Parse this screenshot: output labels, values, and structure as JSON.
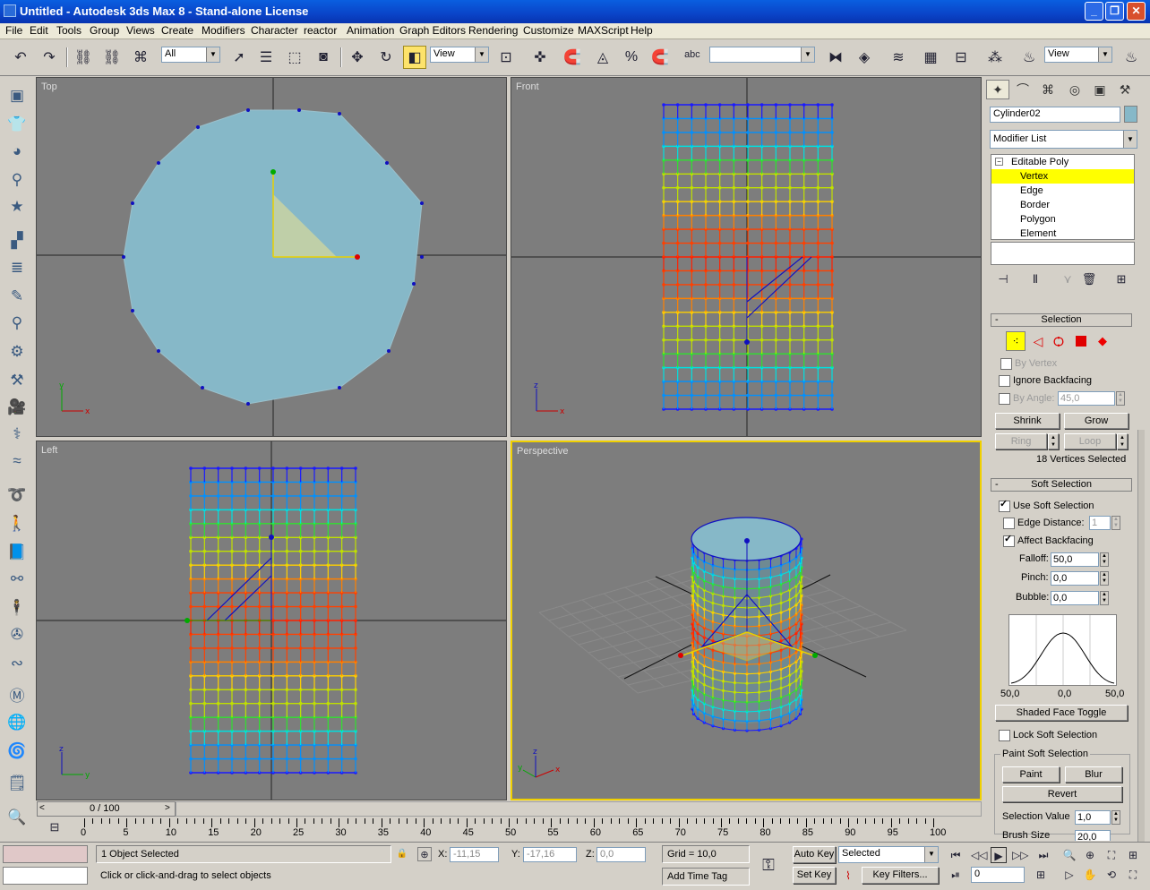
{
  "window": {
    "title": "Untitled   - Autodesk 3ds Max 8   - Stand-alone License"
  },
  "menu": [
    "File",
    "Edit",
    "Tools",
    "Group",
    "Views",
    "Create",
    "Modifiers",
    "Character",
    "reactor",
    "Animation",
    "Graph Editors",
    "Rendering",
    "Customize",
    "MAXScript",
    "Help"
  ],
  "toolbar": {
    "selection_filter": "All",
    "ref_coord": "View",
    "named_sel": "",
    "render_view": "View",
    "snap_label": "3",
    "angle_snap": "%"
  },
  "viewports": {
    "top": "Top",
    "front": "Front",
    "left": "Left",
    "perspective": "Perspective"
  },
  "command_panel": {
    "object_name": "Cylinder02",
    "modifier_list": "Modifier List",
    "stack": {
      "root": "Editable Poly",
      "items": [
        "Vertex",
        "Edge",
        "Border",
        "Polygon",
        "Element"
      ],
      "selected": "Vertex"
    },
    "selection": {
      "title": "Selection",
      "by_vertex": "By Vertex",
      "ignore_backfacing": "Ignore Backfacing",
      "by_angle": "By Angle:",
      "by_angle_value": "45,0",
      "shrink": "Shrink",
      "grow": "Grow",
      "ring": "Ring",
      "loop": "Loop",
      "status": "18 Vertices Selected"
    },
    "soft_selection": {
      "title": "Soft Selection",
      "use_soft": "Use Soft Selection",
      "edge_distance": "Edge Distance:",
      "edge_distance_value": "1",
      "affect_backfacing": "Affect Backfacing",
      "falloff_label": "Falloff:",
      "falloff": "50,0",
      "pinch_label": "Pinch:",
      "pinch": "0,0",
      "bubble_label": "Bubble:",
      "bubble": "0,0",
      "curve_left": "50,0",
      "curve_mid": "0,0",
      "curve_right": "50,0",
      "shaded_face_toggle": "Shaded Face Toggle",
      "lock_soft": "Lock Soft Selection",
      "paint_group": "Paint Soft Selection",
      "paint": "Paint",
      "blur": "Blur",
      "revert": "Revert",
      "selection_value_label": "Selection Value",
      "selection_value": "1,0",
      "brush_size_label": "Brush Size",
      "brush_size": "20,0"
    }
  },
  "timeline": {
    "frame": "0 / 100",
    "ticks": [
      "0",
      "5",
      "10",
      "15",
      "20",
      "25",
      "30",
      "35",
      "40",
      "45",
      "50",
      "55",
      "60",
      "65",
      "70",
      "75",
      "80",
      "85",
      "90",
      "95",
      "100"
    ]
  },
  "status": {
    "objects": "1 Object Selected",
    "prompt": "Click or click-and-drag to select objects",
    "x_label": "X:",
    "x": "-11,15",
    "y_label": "Y:",
    "y": "-17,16",
    "z_label": "Z:",
    "z": "0,0",
    "grid": "Grid = 10,0",
    "add_time_tag": "Add Time Tag",
    "auto_key": "Auto Key",
    "set_key": "Set Key",
    "key_mode": "Selected",
    "key_filters": "Key Filters...",
    "current_frame": "0"
  }
}
